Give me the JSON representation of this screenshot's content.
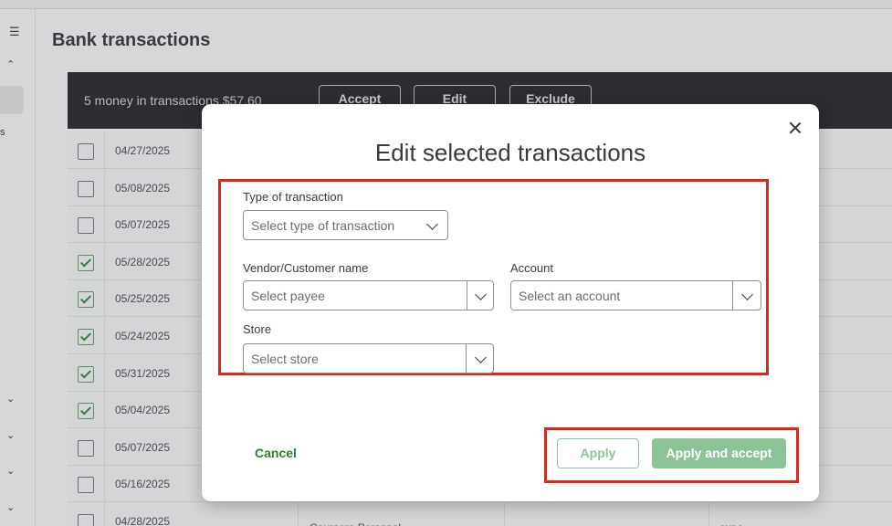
{
  "page": {
    "title": "Bank transactions"
  },
  "sidebar": {
    "menu_icon": "collapse-menu-icon",
    "partial_text": "s",
    "chevrons": [
      "chevron-up-icon",
      "chevron-down-icon",
      "chevron-down-icon",
      "chevron-down-icon",
      "chevron-down-icon"
    ]
  },
  "batch_bar": {
    "count_text": "5 money in transactions $57.60",
    "accept_label": "Accept",
    "edit_label": "Edit",
    "exclude_label": "Exclude"
  },
  "rows": [
    {
      "date": "04/27/2025",
      "checked": false
    },
    {
      "date": "05/08/2025",
      "checked": false
    },
    {
      "date": "05/07/2025",
      "checked": false
    },
    {
      "date": "05/28/2025",
      "checked": true
    },
    {
      "date": "05/25/2025",
      "checked": true
    },
    {
      "date": "05/24/2025",
      "checked": true
    },
    {
      "date": "05/31/2025",
      "checked": true
    },
    {
      "date": "05/04/2025",
      "checked": true
    },
    {
      "date": "05/07/2025",
      "checked": false
    },
    {
      "date": "05/16/2025",
      "checked": false
    },
    {
      "date": "04/28/2025",
      "checked": false,
      "description": "Coursera Personal",
      "category": "expe"
    }
  ],
  "modal": {
    "title": "Edit selected transactions",
    "close_icon": "close-icon",
    "type_of_transaction": {
      "label": "Type of transaction",
      "placeholder": "Select type of transaction"
    },
    "vendor": {
      "label": "Vendor/Customer name",
      "placeholder": "Select payee"
    },
    "account": {
      "label": "Account",
      "placeholder": "Select an account"
    },
    "store": {
      "label": "Store",
      "placeholder": "Select store"
    },
    "cancel_label": "Cancel",
    "apply_label": "Apply",
    "apply_accept_label": "Apply and accept"
  },
  "colors": {
    "accent_green": "#2e7d32",
    "button_green_disabled": "#8cc49a",
    "highlight_red": "#d52b1e",
    "batch_bar_bg": "#2c2d30"
  }
}
